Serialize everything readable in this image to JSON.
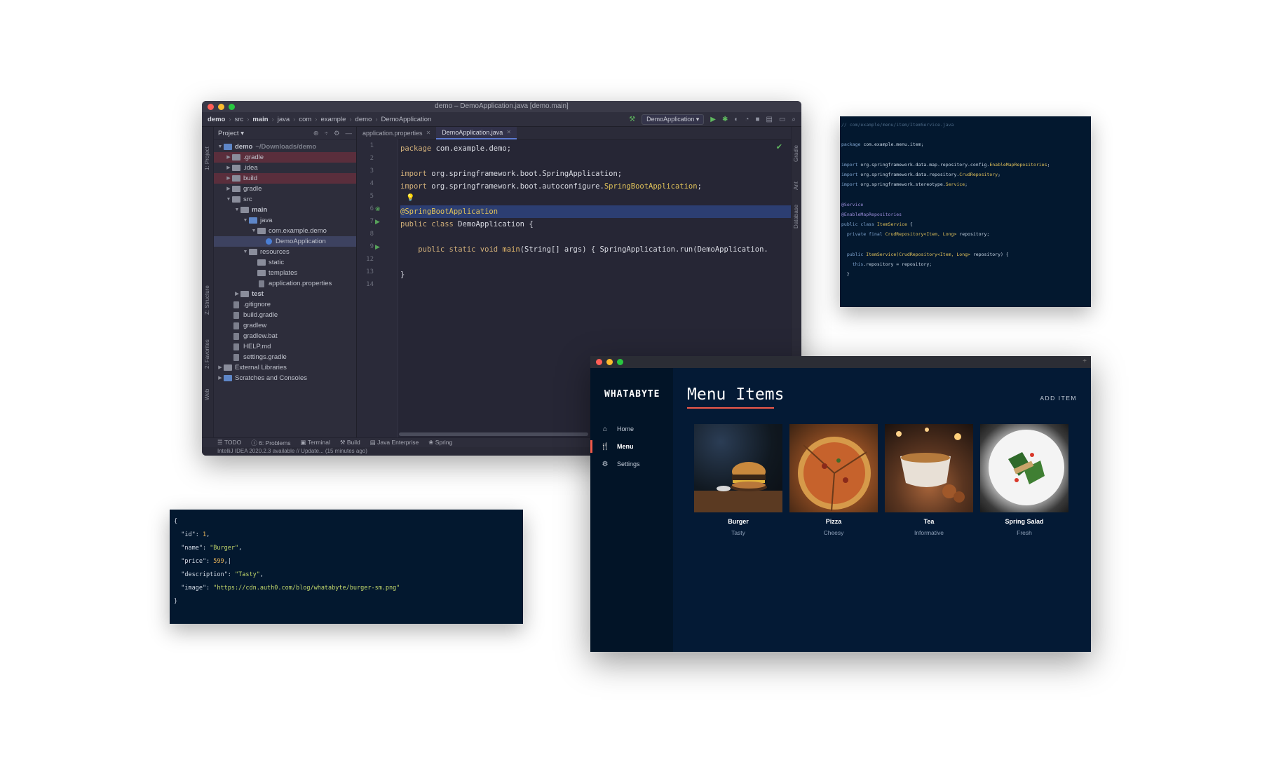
{
  "ide": {
    "window_title": "demo – DemoApplication.java [demo.main]",
    "breadcrumbs": [
      "demo",
      "src",
      "main",
      "java",
      "com",
      "example",
      "demo",
      "DemoApplication"
    ],
    "run_config": "DemoApplication",
    "panel_title": "Project",
    "tree": [
      {
        "label": "demo",
        "hint": "~/Downloads/demo"
      },
      {
        "label": ".gradle"
      },
      {
        "label": ".idea"
      },
      {
        "label": "build"
      },
      {
        "label": "gradle"
      },
      {
        "label": "src"
      },
      {
        "label": "main"
      },
      {
        "label": "java"
      },
      {
        "label": "com.example.demo"
      },
      {
        "label": "DemoApplication"
      },
      {
        "label": "resources"
      },
      {
        "label": "static"
      },
      {
        "label": "templates"
      },
      {
        "label": "application.properties"
      },
      {
        "label": "test"
      },
      {
        "label": ".gitignore"
      },
      {
        "label": "build.gradle"
      },
      {
        "label": "gradlew"
      },
      {
        "label": "gradlew.bat"
      },
      {
        "label": "HELP.md"
      },
      {
        "label": "settings.gradle"
      },
      {
        "label": "External Libraries"
      },
      {
        "label": "Scratches and Consoles"
      }
    ],
    "tabs": [
      "application.properties",
      "DemoApplication.java"
    ],
    "line_numbers": [
      "1",
      "2",
      "3",
      "4",
      "5",
      "6",
      "7",
      "8",
      "9",
      "12",
      "13",
      "14"
    ],
    "code": {
      "l1_kw": "package",
      "l1_rest": " com.example.demo;",
      "l3_kw": "import",
      "l3_rest": " org.springframework.boot.SpringApplication;",
      "l4_kw": "import",
      "l4_rest": " org.springframework.boot.autoconfigure.",
      "l4_cls": "SpringBootApplication",
      "l4_end": ";",
      "l6_ann": "@SpringBootApplication",
      "l7_kw": "public class",
      "l7_rest": " DemoApplication {",
      "l9_kw": "public static void",
      "l9_mth": " main",
      "l9_rest": "(String[] args) { SpringApplication.run(DemoApplication.",
      "l13": "}"
    },
    "left_strip_tabs": [
      "1: Project",
      "Z: Structure",
      "2: Favorites",
      "Web"
    ],
    "right_strip_tabs": [
      "Gradle",
      "Ant",
      "Database"
    ],
    "tool_tabs": [
      "TODO",
      "6: Problems",
      "Terminal",
      "Build",
      "Java Enterprise",
      "Spring"
    ],
    "status": "IntelliJ IDEA 2020.2.3 available // Update... (15 minutes ago)"
  },
  "snippet": {
    "lines": [
      {
        "parts": [
          {
            "c": "c",
            "t": "// com/example/menu/item/ItemService.java"
          }
        ]
      },
      {
        "parts": [
          {
            "c": "",
            "t": ""
          }
        ]
      },
      {
        "parts": [
          {
            "c": "k",
            "t": "package"
          },
          {
            "c": "",
            "t": " com.example.menu.item;"
          }
        ]
      },
      {
        "parts": [
          {
            "c": "",
            "t": ""
          }
        ]
      },
      {
        "parts": [
          {
            "c": "k",
            "t": "import"
          },
          {
            "c": "",
            "t": " org.springframework.data.map.repository.config."
          },
          {
            "c": "t",
            "t": "EnableMapRepositories"
          },
          {
            "c": "",
            "t": ";"
          }
        ]
      },
      {
        "parts": [
          {
            "c": "k",
            "t": "import"
          },
          {
            "c": "",
            "t": " org.springframework.data.repository."
          },
          {
            "c": "t",
            "t": "CrudRepository"
          },
          {
            "c": "",
            "t": ";"
          }
        ]
      },
      {
        "parts": [
          {
            "c": "k",
            "t": "import"
          },
          {
            "c": "",
            "t": " org.springframework.stereotype."
          },
          {
            "c": "t",
            "t": "Service"
          },
          {
            "c": "",
            "t": ";"
          }
        ]
      },
      {
        "parts": [
          {
            "c": "",
            "t": ""
          }
        ]
      },
      {
        "parts": [
          {
            "c": "a",
            "t": "@Service"
          }
        ]
      },
      {
        "parts": [
          {
            "c": "a",
            "t": "@EnableMapRepositories"
          }
        ]
      },
      {
        "parts": [
          {
            "c": "k",
            "t": "public class"
          },
          {
            "c": "t",
            "t": " ItemService"
          },
          {
            "c": "",
            "t": " {"
          }
        ]
      },
      {
        "parts": [
          {
            "c": "k",
            "t": "  private final"
          },
          {
            "c": "t",
            "t": " CrudRepository<Item, Long>"
          },
          {
            "c": "",
            "t": " repository;"
          }
        ]
      },
      {
        "parts": [
          {
            "c": "",
            "t": ""
          }
        ]
      },
      {
        "parts": [
          {
            "c": "k",
            "t": "  public"
          },
          {
            "c": "t",
            "t": " ItemService(CrudRepository<Item, Long>"
          },
          {
            "c": "",
            "t": " repository) {"
          }
        ]
      },
      {
        "parts": [
          {
            "c": "k",
            "t": "    this"
          },
          {
            "c": "",
            "t": ".repository = repository;"
          }
        ]
      },
      {
        "parts": [
          {
            "c": "",
            "t": "  }"
          }
        ]
      }
    ]
  },
  "json_panel": {
    "lines": [
      {
        "parts": [
          {
            "c": "",
            "t": "{"
          }
        ]
      },
      {
        "parts": [
          {
            "c": "key",
            "t": "  \"id\": "
          },
          {
            "c": "num",
            "t": "1"
          },
          {
            "c": "",
            "t": ","
          }
        ]
      },
      {
        "parts": [
          {
            "c": "key",
            "t": "  \"name\": "
          },
          {
            "c": "str",
            "t": "\"Burger\""
          },
          {
            "c": "",
            "t": ","
          }
        ]
      },
      {
        "parts": [
          {
            "c": "key",
            "t": "  \"price\": "
          },
          {
            "c": "num",
            "t": "599"
          },
          {
            "c": "",
            "t": ",|"
          }
        ]
      },
      {
        "parts": [
          {
            "c": "key",
            "t": "  \"description\": "
          },
          {
            "c": "str",
            "t": "\"Tasty\""
          },
          {
            "c": "",
            "t": ","
          }
        ]
      },
      {
        "parts": [
          {
            "c": "key",
            "t": "  \"image\": "
          },
          {
            "c": "str",
            "t": "\"https://cdn.auth0.com/blog/whatabyte/burger-sm.png\""
          }
        ]
      },
      {
        "parts": [
          {
            "c": "",
            "t": "}"
          }
        ]
      }
    ]
  },
  "app": {
    "brand": "WHATABYTE",
    "nav": [
      {
        "label": "Home",
        "icon": "home-icon"
      },
      {
        "label": "Menu",
        "icon": "utensils-icon"
      },
      {
        "label": "Settings",
        "icon": "gear-icon"
      }
    ],
    "page_title": "Menu Items",
    "add_item": "ADD ITEM",
    "items": [
      {
        "name": "Burger",
        "description": "Tasty"
      },
      {
        "name": "Pizza",
        "description": "Cheesy"
      },
      {
        "name": "Tea",
        "description": "Informative"
      },
      {
        "name": "Spring Salad",
        "description": "Fresh"
      }
    ],
    "accent_color": "#f05a4a"
  }
}
